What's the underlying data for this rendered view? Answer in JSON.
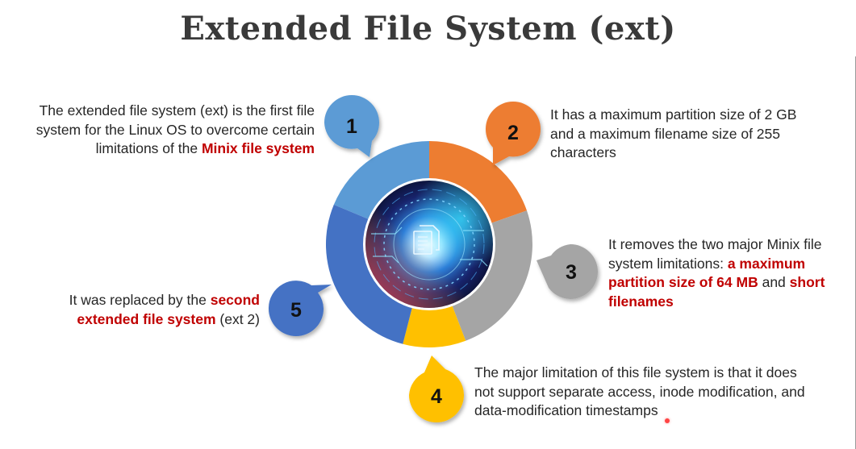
{
  "title": "Extended File System (ext)",
  "colors": {
    "segment_1": "#5b9bd5",
    "segment_2": "#ed7d31",
    "segment_3": "#a5a5a5",
    "segment_4": "#ffc000",
    "segment_5": "#4472c4",
    "highlight": "#c00000"
  },
  "center_icon": "document-icon",
  "items": [
    {
      "number": "1",
      "text_before": "The extended file system (ext) is the first file system for the Linux OS to overcome certain limitations of the ",
      "highlight": "Minix file system",
      "text_after": ""
    },
    {
      "number": "2",
      "text": "It has a maximum partition size of 2 GB and a maximum filename size of 255 characters"
    },
    {
      "number": "3",
      "text_before": "It removes the two major Minix file system limitations: ",
      "highlight_1": "a maximum partition size of 64 MB",
      "text_middle": " and ",
      "highlight_2": "short filenames"
    },
    {
      "number": "4",
      "text": "The major limitation of this file system is that it does not support separate access, inode modification, and data-modification timestamps"
    },
    {
      "number": "5",
      "text_before": "It was replaced by the ",
      "highlight": "second extended file system",
      "text_after": " (ext 2)"
    }
  ]
}
